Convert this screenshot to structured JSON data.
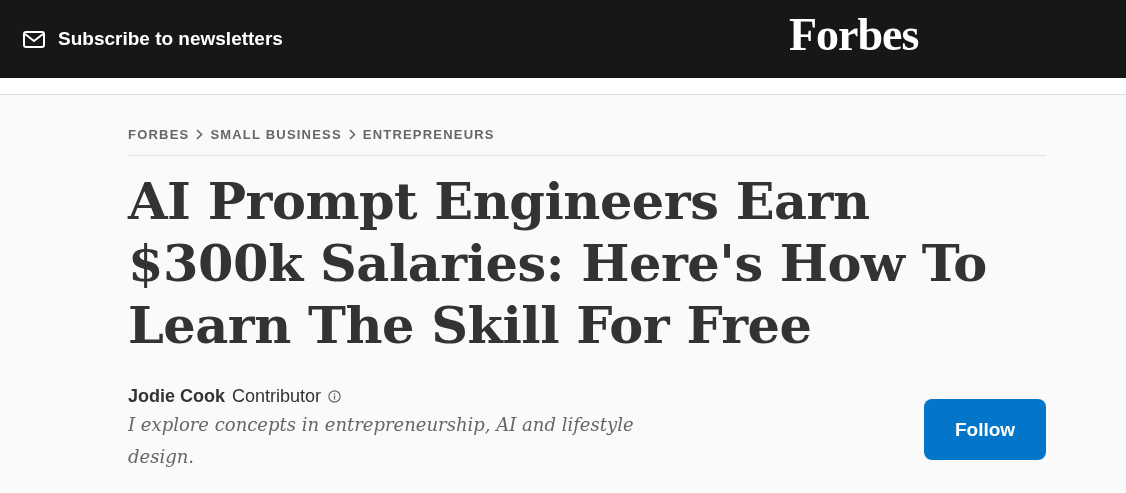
{
  "header": {
    "subscribe_label": "Subscribe to newsletters",
    "logo": "Forbes"
  },
  "breadcrumbs": [
    "FORBES",
    "SMALL BUSINESS",
    "ENTREPRENEURS"
  ],
  "headline": "AI Prompt Engineers Earn $300k Salaries: Here's How To Learn The Skill For Free",
  "author": {
    "name": "Jodie Cook",
    "role": "Contributor",
    "bio": "I explore concepts in entrepreneurship, AI and lifestyle design."
  },
  "follow_button": "Follow"
}
